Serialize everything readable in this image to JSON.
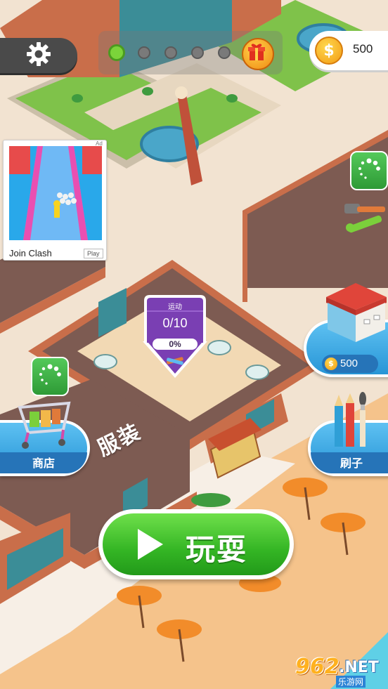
{
  "hud": {
    "settings_icon": "gear-icon",
    "progress_dots": [
      {
        "state": "active"
      },
      {
        "state": "inactive"
      },
      {
        "state": "inactive"
      },
      {
        "state": "inactive"
      },
      {
        "state": "inactive"
      }
    ],
    "gift_icon": "gift-box-icon",
    "coins": "500",
    "coin_symbol": "$"
  },
  "ad": {
    "title": "Join Clash",
    "cta": "Play",
    "badge": "Ad"
  },
  "workshop": {
    "category": "运动",
    "progress_count": "0/10",
    "progress_percent": "0%",
    "progress_fraction": 0
  },
  "buttons": {
    "shop_label": "商店",
    "brush_label": "刷子",
    "house_price": "500",
    "play_label": "玩耍"
  },
  "zone": {
    "label": "服装"
  },
  "watermark": {
    "number": "962",
    "suffix": ".NET",
    "sub": "乐游网"
  },
  "colors": {
    "accent_green": "#34b524",
    "button_blue": "#2795d6",
    "sign_purple": "#7a3fb3",
    "coin_gold": "#f29b14"
  }
}
